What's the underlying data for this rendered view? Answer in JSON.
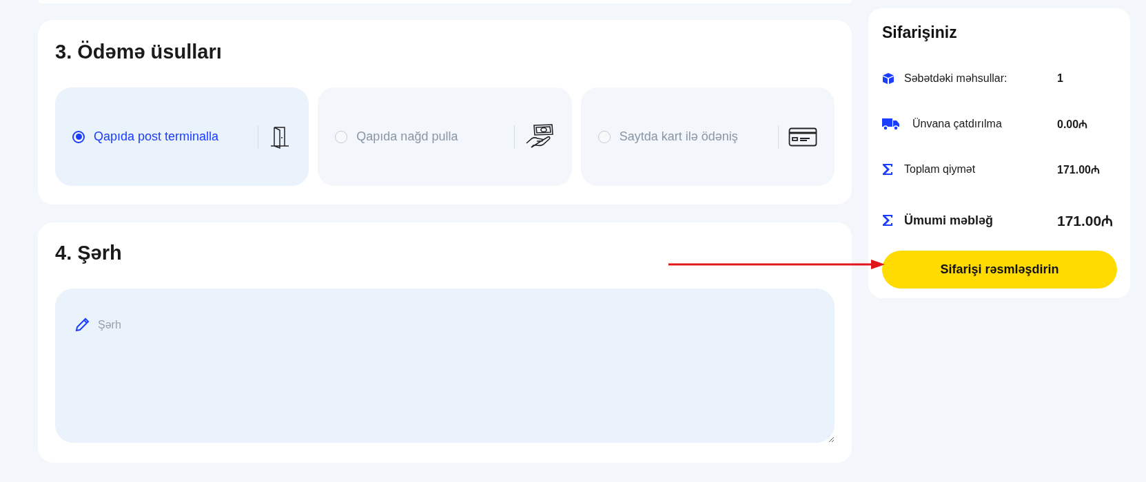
{
  "payment": {
    "title": "3. Ödəmə üsulları",
    "methods": [
      {
        "label": "Qapıda post terminalla",
        "kind": "door",
        "selected": true
      },
      {
        "label": "Qapıda nağd pulla",
        "kind": "cash",
        "selected": false
      },
      {
        "label": "Saytda kart ilə ödəniş",
        "kind": "card",
        "selected": false
      }
    ]
  },
  "comment": {
    "title": "4. Şərh",
    "placeholder": "Şərh"
  },
  "summary": {
    "title": "Sifarişiniz",
    "rows": [
      {
        "kind": "items",
        "label": "Səbətdəki məhsullar:",
        "value": "1"
      },
      {
        "kind": "delivery",
        "label": "Ünvana çatdırılma",
        "value": "0.00₼"
      },
      {
        "kind": "subtotal",
        "label": "Toplam qiymət",
        "value": "171.00₼"
      },
      {
        "kind": "total",
        "label": "Ümumi məbləğ",
        "value": "171.00₼"
      }
    ],
    "button": "Sifarişi rəsmləşdirin"
  }
}
